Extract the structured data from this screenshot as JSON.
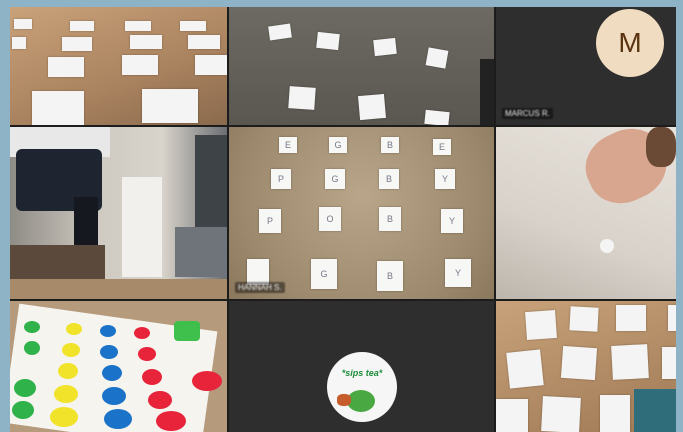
{
  "participants": [
    {
      "name": "",
      "video": "floor-papers"
    },
    {
      "name": "",
      "video": "floor-papers-dark"
    },
    {
      "name": "MARCUS R.",
      "avatar_initial": "M",
      "avatar_color": "#f0dcc0"
    },
    {
      "name": "",
      "video": "person-room"
    },
    {
      "name": "HANNAH S.",
      "video": "letter-cards"
    },
    {
      "name": "",
      "video": "face-closeup"
    },
    {
      "name": "",
      "video": "twister-mat"
    },
    {
      "name": "",
      "sticker_text": "*sips tea*"
    },
    {
      "name": "",
      "video": "floor-papers-wood"
    }
  ],
  "letter_cards": [
    "E",
    "G",
    "B",
    "E",
    "P",
    "G",
    "B",
    "Y",
    "P",
    "O",
    "B",
    "Y",
    "",
    "G",
    "B",
    "Y"
  ],
  "colors": {
    "background": "#8fb3c6",
    "grid_gap": "#1c1c1c",
    "accent_green": "#1d8e3a"
  }
}
